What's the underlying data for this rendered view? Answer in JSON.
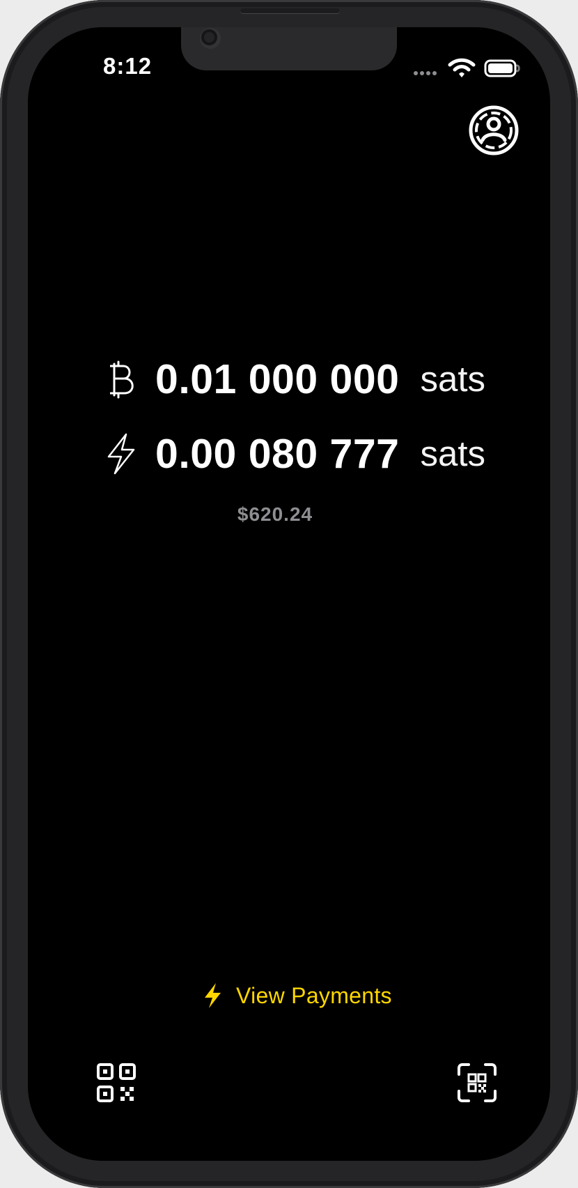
{
  "status_bar": {
    "time": "8:12",
    "icons": [
      "signal-dots-icon",
      "wifi-icon",
      "battery-icon"
    ]
  },
  "header": {
    "profile_icon": "profile-circle-icon"
  },
  "balances": [
    {
      "icon": "bitcoin-icon",
      "amount": "0.01 000 000",
      "unit": "sats"
    },
    {
      "icon": "lightning-icon",
      "amount": "0.00 080 777",
      "unit": "sats"
    }
  ],
  "fiat_total": "$620.24",
  "actions": {
    "view_payments_label": "View Payments",
    "view_payments_icon": "lightning-icon",
    "receive_icon": "qr-code-icon",
    "scan_icon": "qr-scan-icon"
  },
  "colors": {
    "background": "#000000",
    "primary_text": "#ffffff",
    "secondary_text": "#8e8e93",
    "accent": "#ffd600",
    "frame": "#252527"
  }
}
